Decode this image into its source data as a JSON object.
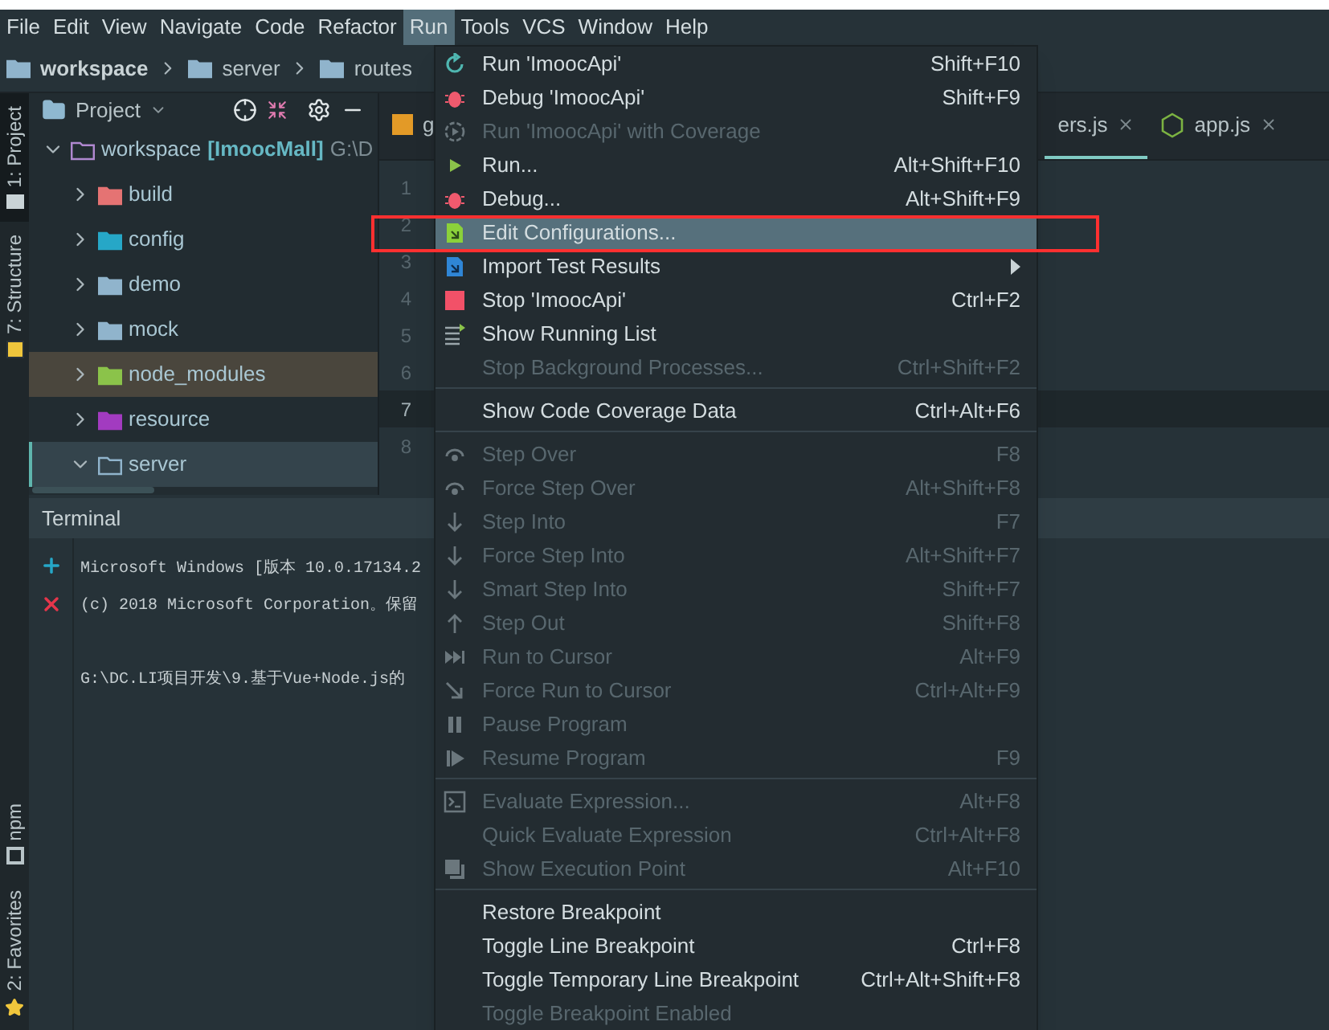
{
  "menubar": [
    {
      "label": "File",
      "selected": false
    },
    {
      "label": "Edit",
      "selected": false
    },
    {
      "label": "View",
      "selected": false
    },
    {
      "label": "Navigate",
      "selected": false
    },
    {
      "label": "Code",
      "selected": false
    },
    {
      "label": "Refactor",
      "selected": false
    },
    {
      "label": "Run",
      "selected": true
    },
    {
      "label": "Tools",
      "selected": false
    },
    {
      "label": "VCS",
      "selected": false
    },
    {
      "label": "Window",
      "selected": false
    },
    {
      "label": "Help",
      "selected": false
    }
  ],
  "breadcrumb": [
    {
      "label": "workspace",
      "kind": "project"
    },
    {
      "label": "server",
      "kind": "folder"
    },
    {
      "label": "routes",
      "kind": "folder"
    }
  ],
  "tool_windows_top": [
    {
      "label": "1: Project",
      "selected": true
    },
    {
      "label": "7: Structure",
      "selected": false
    }
  ],
  "tool_windows_bottom": [
    {
      "label": "npm",
      "selected": false
    },
    {
      "label": "2: Favorites",
      "selected": false
    }
  ],
  "project_panel": {
    "title": "Project",
    "tree": [
      {
        "name": "workspace",
        "module": "[ImoocMall]",
        "path": "G:\\D",
        "expanded": true,
        "selected": false,
        "excluded": false,
        "color": "#b088d0",
        "children": [
          {
            "name": "build",
            "expanded": false,
            "selected": false,
            "excluded": false,
            "color": "#e57373"
          },
          {
            "name": "config",
            "expanded": false,
            "selected": false,
            "excluded": false,
            "color": "#26a7c7"
          },
          {
            "name": "demo",
            "expanded": false,
            "selected": false,
            "excluded": false,
            "color": "#90b4cc"
          },
          {
            "name": "mock",
            "expanded": false,
            "selected": false,
            "excluded": false,
            "color": "#90b4cc"
          },
          {
            "name": "node_modules",
            "expanded": false,
            "selected": false,
            "excluded": true,
            "color": "#8bc34a"
          },
          {
            "name": "resource",
            "expanded": false,
            "selected": false,
            "excluded": false,
            "color": "#a23bc0"
          },
          {
            "name": "server",
            "expanded": true,
            "selected": true,
            "excluded": false,
            "color": "#90b4cc"
          }
        ]
      }
    ]
  },
  "editor": {
    "tabs": [
      {
        "label": "g",
        "selected": false
      },
      {
        "label": "ers.js",
        "selected": true
      },
      {
        "label": "app.js",
        "selected": false
      }
    ],
    "lines": [
      {
        "number": "1",
        "current": false
      },
      {
        "number": "2",
        "current": false
      },
      {
        "number": "3",
        "current": false
      },
      {
        "number": "4",
        "current": false
      },
      {
        "number": "5",
        "current": false
      },
      {
        "number": "6",
        "current": false
      },
      {
        "number": "7",
        "current": true
      },
      {
        "number": "8",
        "current": false
      }
    ]
  },
  "terminal": {
    "title": "Terminal",
    "blocks": [
      [
        "Microsoft Windows [版本 10.0.17134.2",
        "(c) 2018 Microsoft Corporation。保留"
      ],
      [
        "G:\\DC.LI项目开发\\9.基于Vue+Node.js的"
      ]
    ]
  },
  "run_menu": [
    {
      "kind": "item",
      "label": "Run 'ImoocApi'",
      "shortcut": "Shift+F10",
      "disabled": false,
      "selected": false,
      "submenu": false
    },
    {
      "kind": "item",
      "label": "Debug 'ImoocApi'",
      "shortcut": "Shift+F9",
      "disabled": false,
      "selected": false,
      "submenu": false
    },
    {
      "kind": "item",
      "label": "Run 'ImoocApi' with Coverage",
      "disabled": true,
      "selected": false,
      "submenu": false
    },
    {
      "kind": "item",
      "label": "Run...",
      "shortcut": "Alt+Shift+F10",
      "disabled": false,
      "selected": false,
      "submenu": false
    },
    {
      "kind": "item",
      "label": "Debug...",
      "shortcut": "Alt+Shift+F9",
      "disabled": false,
      "selected": false,
      "submenu": false
    },
    {
      "kind": "item",
      "label": "Edit Configurations...",
      "disabled": false,
      "selected": true,
      "submenu": false
    },
    {
      "kind": "item",
      "label": "Import Test Results",
      "disabled": false,
      "selected": false,
      "submenu": true
    },
    {
      "kind": "item",
      "label": "Stop 'ImoocApi'",
      "shortcut": "Ctrl+F2",
      "disabled": false,
      "selected": false,
      "submenu": false
    },
    {
      "kind": "item",
      "label": "Show Running List",
      "disabled": false,
      "selected": false,
      "submenu": false
    },
    {
      "kind": "item",
      "label": "Stop Background Processes...",
      "shortcut": "Ctrl+Shift+F2",
      "disabled": true,
      "selected": false,
      "submenu": false
    },
    {
      "kind": "separator"
    },
    {
      "kind": "item",
      "label": "Show Code Coverage Data",
      "shortcut": "Ctrl+Alt+F6",
      "disabled": false,
      "selected": false,
      "submenu": false
    },
    {
      "kind": "separator"
    },
    {
      "kind": "item",
      "label": "Step Over",
      "shortcut": "F8",
      "disabled": true,
      "selected": false,
      "submenu": false
    },
    {
      "kind": "item",
      "label": "Force Step Over",
      "shortcut": "Alt+Shift+F8",
      "disabled": true,
      "selected": false,
      "submenu": false
    },
    {
      "kind": "item",
      "label": "Step Into",
      "shortcut": "F7",
      "disabled": true,
      "selected": false,
      "submenu": false
    },
    {
      "kind": "item",
      "label": "Force Step Into",
      "shortcut": "Alt+Shift+F7",
      "disabled": true,
      "selected": false,
      "submenu": false
    },
    {
      "kind": "item",
      "label": "Smart Step Into",
      "shortcut": "Shift+F7",
      "disabled": true,
      "selected": false,
      "submenu": false
    },
    {
      "kind": "item",
      "label": "Step Out",
      "shortcut": "Shift+F8",
      "disabled": true,
      "selected": false,
      "submenu": false
    },
    {
      "kind": "item",
      "label": "Run to Cursor",
      "shortcut": "Alt+F9",
      "disabled": true,
      "selected": false,
      "submenu": false
    },
    {
      "kind": "item",
      "label": "Force Run to Cursor",
      "shortcut": "Ctrl+Alt+F9",
      "disabled": true,
      "selected": false,
      "submenu": false
    },
    {
      "kind": "item",
      "label": "Pause Program",
      "disabled": true,
      "selected": false,
      "submenu": false
    },
    {
      "kind": "item",
      "label": "Resume Program",
      "shortcut": "F9",
      "disabled": true,
      "selected": false,
      "submenu": false
    },
    {
      "kind": "separator"
    },
    {
      "kind": "item",
      "label": "Evaluate Expression...",
      "shortcut": "Alt+F8",
      "disabled": true,
      "selected": false,
      "submenu": false
    },
    {
      "kind": "item",
      "label": "Quick Evaluate Expression",
      "shortcut": "Ctrl+Alt+F8",
      "disabled": true,
      "selected": false,
      "submenu": false
    },
    {
      "kind": "item",
      "label": "Show Execution Point",
      "shortcut": "Alt+F10",
      "disabled": true,
      "selected": false,
      "submenu": false
    },
    {
      "kind": "separator"
    },
    {
      "kind": "item",
      "label": "Restore Breakpoint",
      "disabled": false,
      "selected": false,
      "submenu": false
    },
    {
      "kind": "item",
      "label": "Toggle Line Breakpoint",
      "shortcut": "Ctrl+F8",
      "disabled": false,
      "selected": false,
      "submenu": false
    },
    {
      "kind": "item",
      "label": "Toggle Temporary Line Breakpoint",
      "shortcut": "Ctrl+Alt+Shift+F8",
      "disabled": false,
      "selected": false,
      "submenu": false
    },
    {
      "kind": "item",
      "label": "Toggle Breakpoint Enabled",
      "disabled": true,
      "selected": false,
      "submenu": false
    }
  ]
}
